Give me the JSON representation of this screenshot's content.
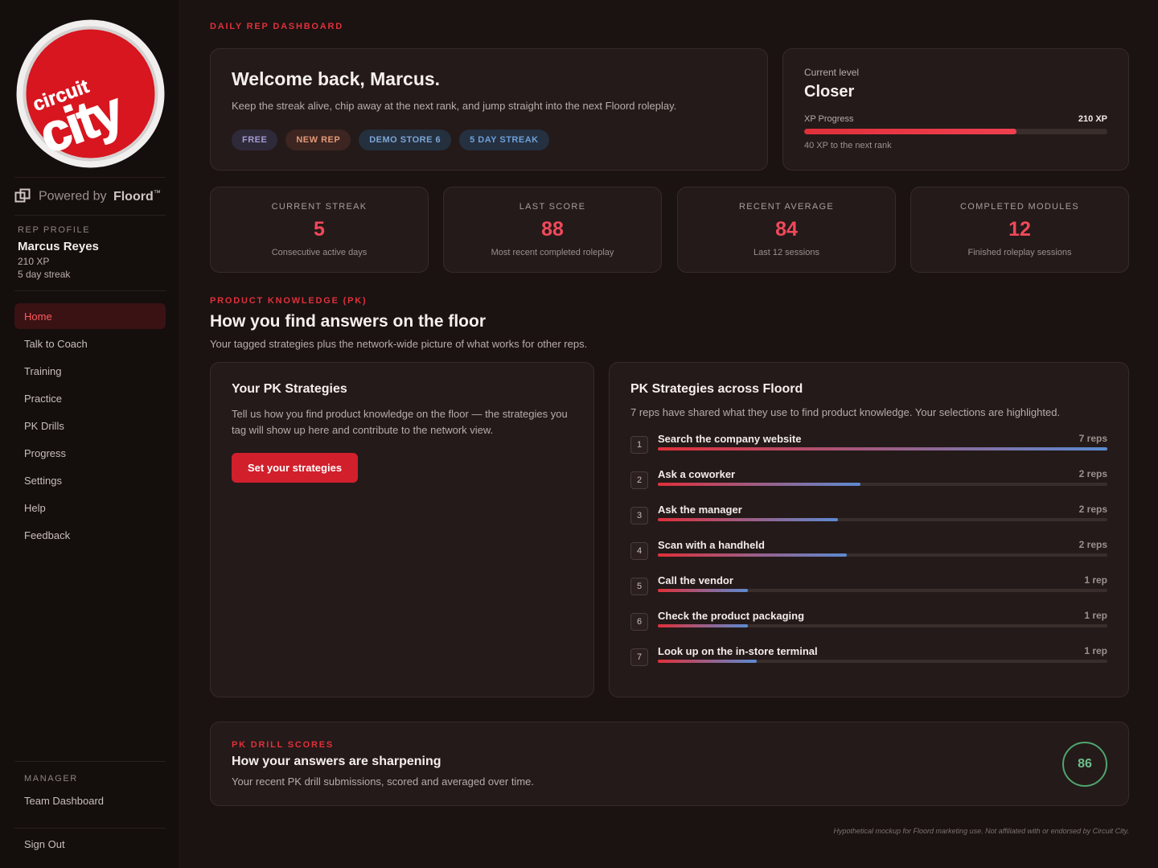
{
  "sidebar": {
    "logo": {
      "line1": "circuit",
      "line2": "city"
    },
    "powered": {
      "prefix": "Powered by",
      "brand": "Floord",
      "tm": "™"
    },
    "profile": {
      "eyebrow": "REP PROFILE",
      "name": "Marcus Reyes",
      "xp": "210 XP",
      "streak": "5 day streak"
    },
    "nav": [
      "Home",
      "Talk to Coach",
      "Training",
      "Practice",
      "PK Drills",
      "Progress",
      "Settings",
      "Help",
      "Feedback"
    ],
    "manager": {
      "eyebrow": "MANAGER",
      "link": "Team Dashboard"
    },
    "signout": "Sign Out"
  },
  "page": {
    "eyebrow": "DAILY REP DASHBOARD"
  },
  "welcome": {
    "title": "Welcome back, Marcus.",
    "body": "Keep the streak alive, chip away at the next rank, and jump straight into the next Floord roleplay.",
    "pills": [
      "FREE",
      "NEW REP",
      "DEMO STORE 6",
      "5 DAY STREAK"
    ]
  },
  "level": {
    "label": "Current level",
    "name": "Closer",
    "progress_label": "XP Progress",
    "xp": "210 XP",
    "progress_fraction": 0.7,
    "next": "40 XP to the next rank"
  },
  "stats": [
    {
      "label": "CURRENT STREAK",
      "value": "5",
      "sub": "Consecutive active days"
    },
    {
      "label": "LAST SCORE",
      "value": "88",
      "sub": "Most recent completed roleplay"
    },
    {
      "label": "RECENT AVERAGE",
      "value": "84",
      "sub": "Last 12 sessions"
    },
    {
      "label": "COMPLETED MODULES",
      "value": "12",
      "sub": "Finished roleplay sessions"
    }
  ],
  "pk": {
    "eyebrow": "PRODUCT KNOWLEDGE (PK)",
    "title": "How you find answers on the floor",
    "subtitle": "Your tagged strategies plus the network-wide picture of what works for other reps."
  },
  "your_pk": {
    "title": "Your PK Strategies",
    "body": "Tell us how you find product knowledge on the floor — the strategies you tag will show up here and contribute to the network view.",
    "button": "Set your strategies"
  },
  "network_pk": {
    "title": "PK Strategies across Floord",
    "desc": "7 reps have shared what they use to find product knowledge. Your selections are highlighted.",
    "items": [
      {
        "num": "1",
        "name": "Search the company website",
        "reps": "7 reps",
        "fraction": 1.0
      },
      {
        "num": "2",
        "name": "Ask a coworker",
        "reps": "2 reps",
        "fraction": 0.45
      },
      {
        "num": "3",
        "name": "Ask the manager",
        "reps": "2 reps",
        "fraction": 0.4
      },
      {
        "num": "4",
        "name": "Scan with a handheld",
        "reps": "2 reps",
        "fraction": 0.42
      },
      {
        "num": "5",
        "name": "Call the vendor",
        "reps": "1 rep",
        "fraction": 0.2
      },
      {
        "num": "6",
        "name": "Check the product packaging",
        "reps": "1 rep",
        "fraction": 0.2
      },
      {
        "num": "7",
        "name": "Look up on the in-store terminal",
        "reps": "1 rep",
        "fraction": 0.22
      }
    ]
  },
  "drill": {
    "eyebrow": "PK DRILL SCORES",
    "title": "How your answers are sharpening",
    "body": "Your recent PK drill submissions, scored and averaged over time.",
    "score": "86"
  },
  "footnote": "Hypothetical mockup for Floord marketing use. Not affiliated with or endorsed by Circuit City.",
  "colors": {
    "accent": "#e0303a",
    "score_green": "#4fa56e",
    "bar_end": "#5b8bd1"
  }
}
